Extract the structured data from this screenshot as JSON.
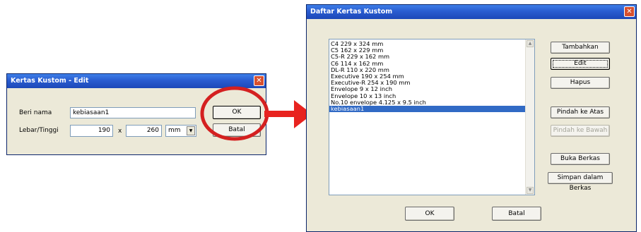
{
  "edit_dialog": {
    "title": "Kertas Kustom - Edit",
    "close_glyph": "✕",
    "name_label": "Beri nama",
    "name_value": "kebiasaan1",
    "size_label": "Lebar/Tinggi",
    "width_value": "190",
    "times_label": "x",
    "height_value": "260",
    "unit_value": "mm",
    "dropdown_glyph": "▼",
    "ok_label": "OK",
    "cancel_label": "Batal"
  },
  "list_dialog": {
    "title": "Daftar Kertas Kustom",
    "close_glyph": "✕",
    "items": [
      "C4 229 x 324 mm",
      "C5 162 x 229 mm",
      "C5-R 229 x 162 mm",
      "C6 114 x 162 mm",
      "DL-R 110 x 220 mm",
      "Executive 190 x 254 mm",
      "Executive-R 254 x 190 mm",
      "Envelope 9 x 12 inch",
      "Envelope 10 x 13 inch",
      "No.10 envelope 4.125 x 9.5 inch",
      "kebiasaan1"
    ],
    "selected_index": 10,
    "scroll_up_glyph": "▲",
    "scroll_down_glyph": "▼",
    "buttons": {
      "add": "Tambahkan",
      "edit": "Edit",
      "delete": "Hapus",
      "move_up": "Pindah ke Atas",
      "move_down": "Pindah ke Bawah",
      "open_file": "Buka Berkas",
      "save_file": "Simpan dalam Berkas",
      "ok": "OK",
      "cancel": "Batal"
    }
  },
  "colors": {
    "highlight_circle": "#d42020",
    "arrow": "#e8231f",
    "titlebar": "#2a5cd0",
    "selection": "#316ac5"
  }
}
